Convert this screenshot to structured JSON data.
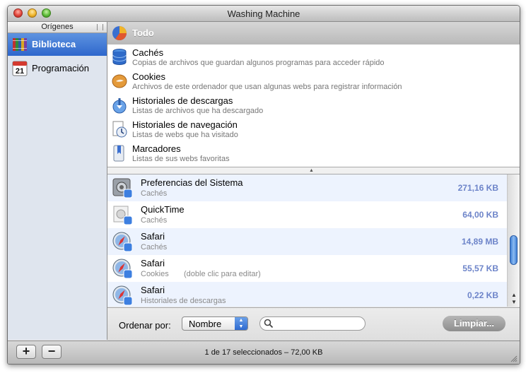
{
  "window": {
    "title": "Washing Machine"
  },
  "sidebar": {
    "header": "Orígenes",
    "items": [
      {
        "label": "Biblioteca",
        "icon": "library-books-icon",
        "selected": true
      },
      {
        "label": "Programación",
        "icon": "calendar-icon",
        "calendar_day": "21"
      }
    ]
  },
  "categories": {
    "all": {
      "label": "Todo",
      "icon": "pie-chart-icon"
    },
    "items": [
      {
        "name": "Cachés",
        "desc": "Copias de archivos que guardan algunos programas para acceder rápido",
        "icon": "database-icon"
      },
      {
        "name": "Cookies",
        "desc": "Archivos de este ordenador que usan algunas webs para registrar información",
        "icon": "cookie-icon"
      },
      {
        "name": "Historiales de descargas",
        "desc": "Listas de archivos que ha descargado",
        "icon": "download-history-icon"
      },
      {
        "name": "Historiales de navegación",
        "desc": "Listas de webs que ha visitado",
        "icon": "browsing-history-icon"
      },
      {
        "name": "Marcadores",
        "desc": "Listas de sus webs favoritas",
        "icon": "bookmark-icon"
      }
    ]
  },
  "list": {
    "rows": [
      {
        "name": "Preferencias del Sistema",
        "type": "Cachés",
        "size": "271,16 KB",
        "icon": "system-preferences-icon",
        "note": ""
      },
      {
        "name": "QuickTime",
        "type": "Cachés",
        "size": "64,00 KB",
        "icon": "quicktime-icon",
        "note": ""
      },
      {
        "name": "Safari",
        "type": "Cachés",
        "size": "14,89 MB",
        "icon": "safari-icon",
        "note": ""
      },
      {
        "name": "Safari",
        "type": "Cookies",
        "size": "55,57 KB",
        "icon": "safari-icon",
        "note": "(doble clic para editar)"
      },
      {
        "name": "Safari",
        "type": "Historiales de descargas",
        "size": "0,22 KB",
        "icon": "safari-icon",
        "note": ""
      }
    ]
  },
  "controls": {
    "sort_label": "Ordenar por:",
    "sort_value": "Nombre",
    "search_placeholder": "",
    "clear_label": "Limpiar..."
  },
  "bottom": {
    "add_label": "+",
    "remove_label": "−",
    "status": "1 de 17 seleccionados – 72,00 KB"
  },
  "colors": {
    "selection": "#2e67cc",
    "size_text": "#6d84c9"
  }
}
